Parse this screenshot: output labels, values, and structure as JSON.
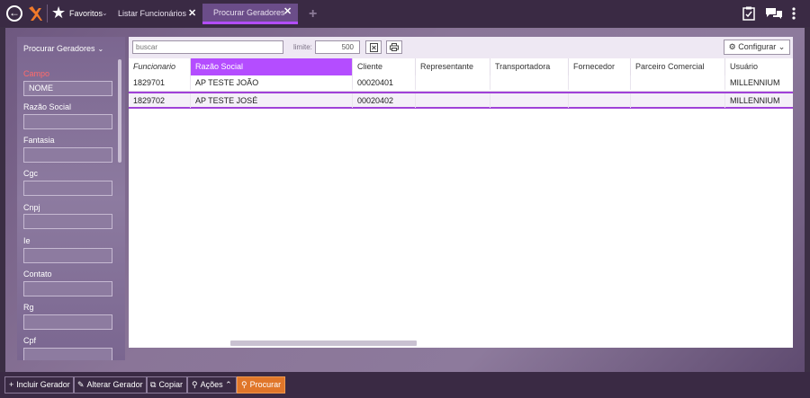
{
  "topbar": {
    "favorites_label": "Favoritos",
    "favorites_caret": "⌄",
    "tabs": [
      {
        "label": "Listar Funcionários",
        "close": "✕"
      },
      {
        "label": "Procurar Geradores",
        "close": "✕"
      }
    ],
    "add_tab": "+",
    "icons": [
      "clipboard-check-icon",
      "chat-icon",
      "kebab-menu-icon"
    ]
  },
  "left_panel": {
    "title": "Procurar Geradores",
    "fields": [
      {
        "label": "Campo",
        "value": "NOME"
      },
      {
        "label": "Razão Social",
        "value": ""
      },
      {
        "label": "Fantasia",
        "value": ""
      },
      {
        "label": "Cgc",
        "value": ""
      },
      {
        "label": "Cnpj",
        "value": ""
      },
      {
        "label": "Ie",
        "value": ""
      },
      {
        "label": "Contato",
        "value": ""
      },
      {
        "label": "Rg",
        "value": ""
      },
      {
        "label": "Cpf",
        "value": ""
      }
    ]
  },
  "toolbar": {
    "search_placeholder": "buscar",
    "limit_label": "limite:",
    "limit_value": "500",
    "config_label": "Configurar"
  },
  "table": {
    "columns": [
      "Funcionario",
      "Razão Social",
      "Cliente",
      "Representante",
      "Transportadora",
      "Fornecedor",
      "Parceiro Comercial",
      "Usuário"
    ],
    "rows": [
      [
        "1829701",
        "AP TESTE JOÃO",
        "00020401",
        "",
        "",
        "",
        "",
        "MILLENNIUM"
      ],
      [
        "1829702",
        "AP TESTE JOSÉ",
        "00020402",
        "",
        "",
        "",
        "",
        "MILLENNIUM"
      ]
    ]
  },
  "bottom_bar": {
    "buttons": [
      {
        "label": "Incluir Gerador",
        "icon": "plus-icon"
      },
      {
        "label": "Alterar Gerador",
        "icon": "edit-icon"
      },
      {
        "label": "Copiar",
        "icon": "copy-icon"
      },
      {
        "label": "Ações",
        "icon": "bulb-icon"
      },
      {
        "label": "Procurar",
        "icon": "search-icon"
      }
    ]
  },
  "colors": {
    "accent": "#b44dff",
    "primary_action": "#e0762a",
    "bar_background": "#3a2a44"
  }
}
